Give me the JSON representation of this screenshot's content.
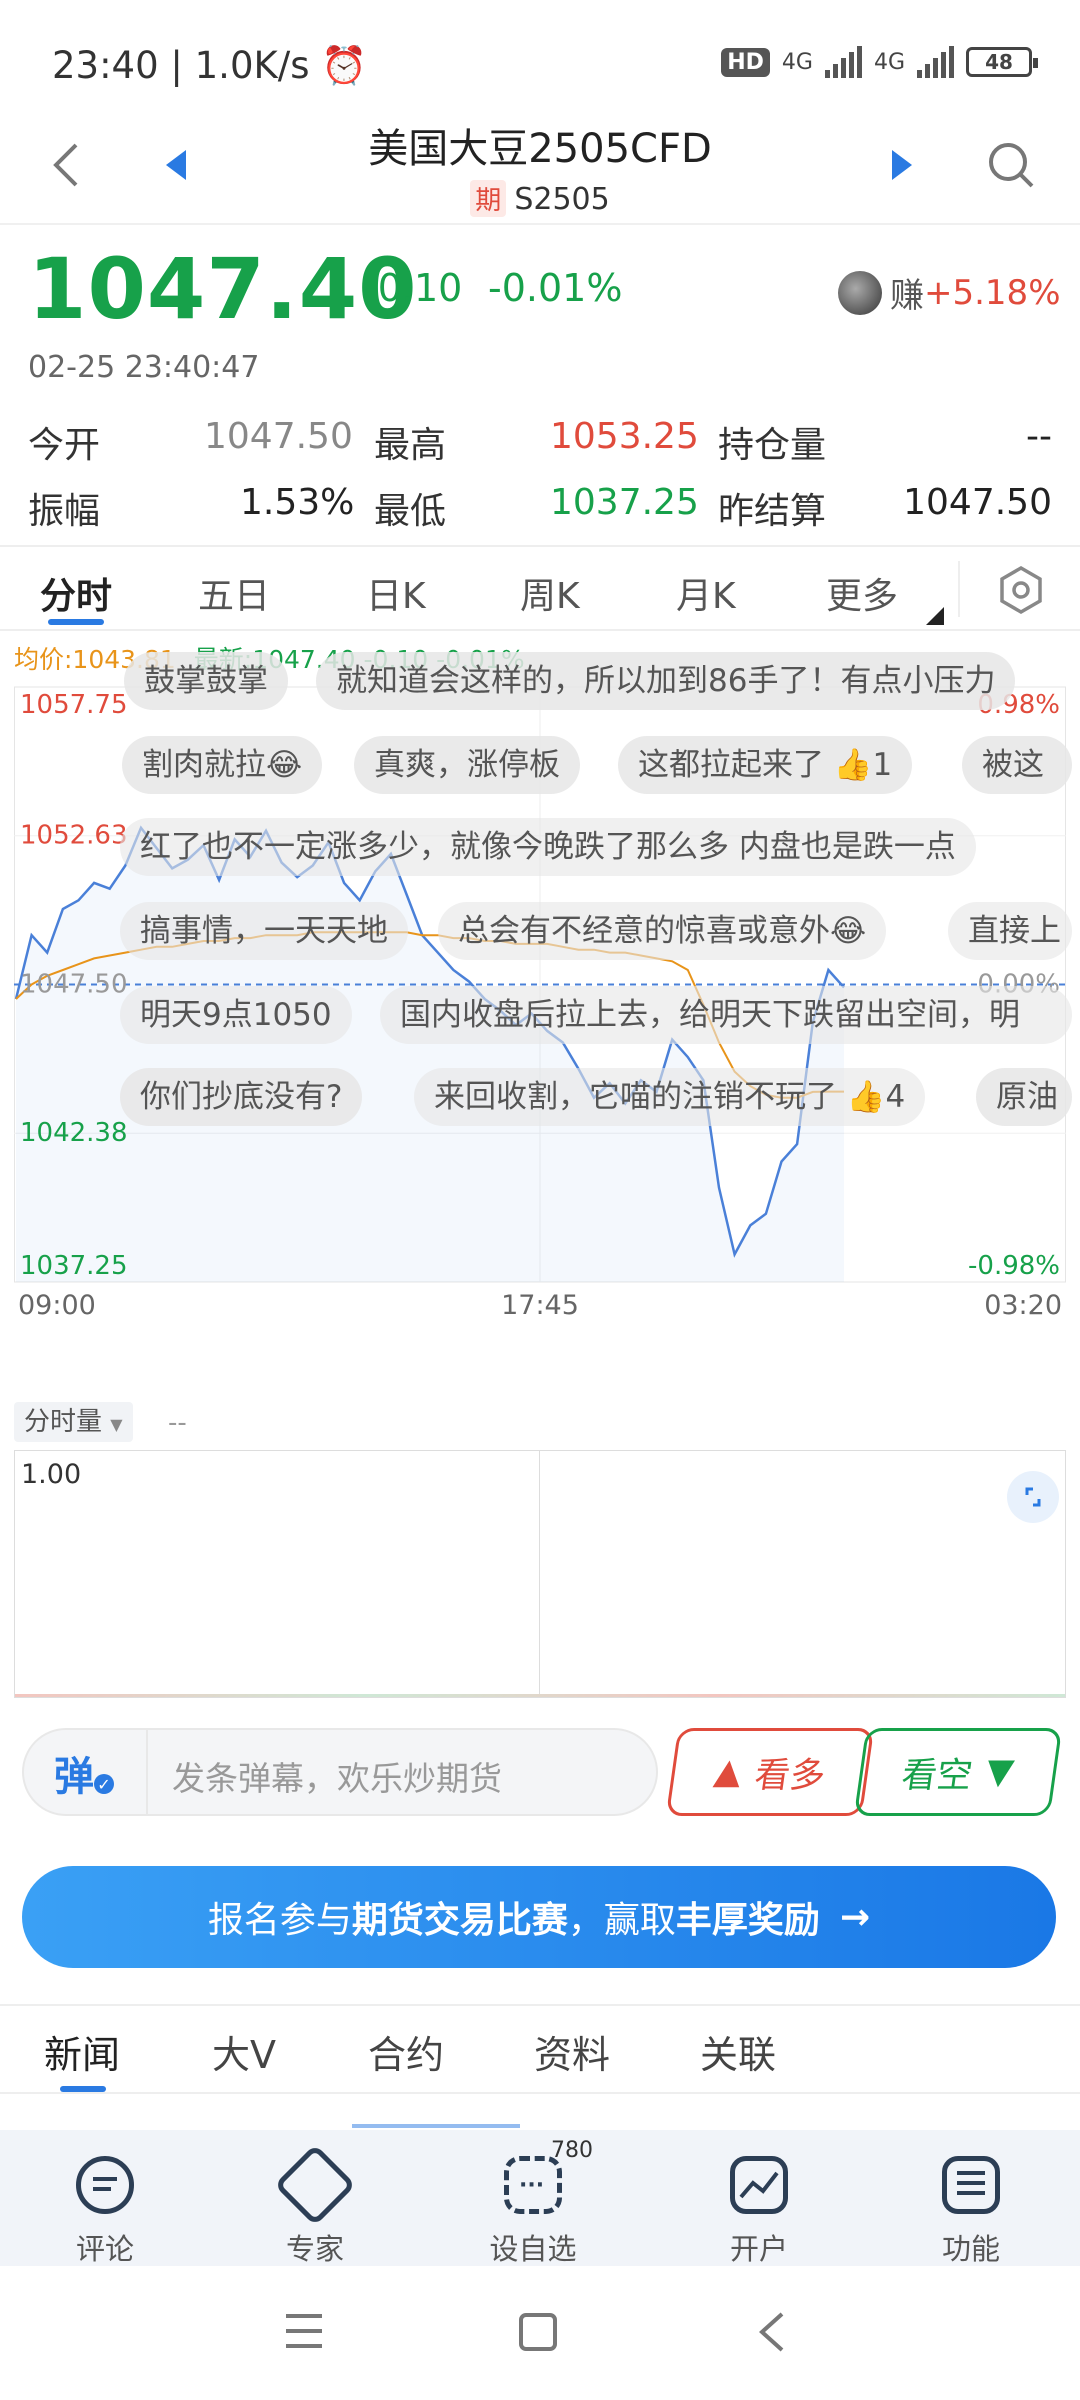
{
  "status_bar": {
    "time": "23:40",
    "speed": "1.0K/s",
    "hd": "HD",
    "net1": "4G",
    "net2": "4G",
    "battery": "48"
  },
  "header": {
    "title": "美国大豆2505CFD",
    "badge": "期",
    "code": "S2505"
  },
  "quote": {
    "price": "1047.40",
    "change": "-0.10",
    "change_pct": "-0.01%",
    "timestamp": "02-25 23:40:47",
    "earn_label": "赚",
    "earn_value": "+5.18%"
  },
  "stats": {
    "open_label": "今开",
    "open": "1047.50",
    "high_label": "最高",
    "high": "1053.25",
    "oi_label": "持仓量",
    "oi": "--",
    "amp_label": "振幅",
    "amp": "1.53%",
    "low_label": "最低",
    "low": "1037.25",
    "settle_label": "昨结算",
    "settle": "1047.50"
  },
  "chart_tabs": [
    "分时",
    "五日",
    "日K",
    "周K",
    "月K",
    "更多"
  ],
  "chart_info": {
    "avg_label": "均价:1043.81",
    "latest_label": "最新:1047.40",
    "latest_chg": "-0.10",
    "latest_pct": "-0.01%"
  },
  "chart_data": {
    "type": "line",
    "y_left_ticks": [
      "1057.75",
      "1052.63",
      "1047.50",
      "1042.38",
      "1037.25"
    ],
    "y_right_ticks": [
      "0.98%",
      "0.00%",
      "-0.98%"
    ],
    "x_ticks": [
      "09:00",
      "17:45",
      "03:20"
    ],
    "ylim": [
      1037.25,
      1057.75
    ],
    "reference": 1047.5,
    "series": [
      {
        "name": "价格",
        "values": [
          1047.0,
          1049.2,
          1048.6,
          1050.1,
          1050.4,
          1051.0,
          1050.8,
          1051.6,
          1052.9,
          1052.2,
          1051.5,
          1051.8,
          1052.3,
          1051.1,
          1052.5,
          1051.9,
          1052.8,
          1051.7,
          1051.2,
          1051.6,
          1052.4,
          1051.0,
          1050.4,
          1051.4,
          1052.0,
          1050.6,
          1049.2,
          1048.6,
          1048.0,
          1047.6,
          1047.0,
          1046.6,
          1046.1,
          1046.5,
          1045.9,
          1045.5,
          1044.6,
          1043.6,
          1044.1,
          1043.4,
          1044.2,
          1043.8,
          1045.6,
          1045.0,
          1044.2,
          1040.5,
          1038.2,
          1039.2,
          1039.6,
          1041.4,
          1042.0,
          1046.2,
          1048.0,
          1047.4
        ]
      },
      {
        "name": "均价",
        "values": [
          1047.0,
          1047.5,
          1047.8,
          1048.0,
          1048.2,
          1048.4,
          1048.5,
          1048.6,
          1048.7,
          1048.8,
          1048.8,
          1048.9,
          1049.0,
          1049.0,
          1049.1,
          1049.1,
          1049.2,
          1049.2,
          1049.2,
          1049.3,
          1049.3,
          1049.3,
          1049.3,
          1049.3,
          1049.3,
          1049.3,
          1049.2,
          1049.2,
          1049.1,
          1049.1,
          1049.0,
          1049.0,
          1048.9,
          1048.9,
          1048.9,
          1048.8,
          1048.7,
          1048.7,
          1048.6,
          1048.6,
          1048.5,
          1048.4,
          1048.3,
          1048.0,
          1046.8,
          1045.5,
          1044.5,
          1044.0,
          1043.7,
          1043.6,
          1043.6,
          1043.8,
          1043.81,
          1043.81
        ]
      }
    ],
    "grid": true
  },
  "danmu": [
    "鼓掌鼓掌",
    "就知道会这样的，所以加到86手了！有点小压力",
    "割肉就拉😂",
    "真爽，涨停板",
    "这都拉起来了",
    "1",
    "被这",
    "红了也不一定涨多少，就像今晚跌了那么多 内盘也是跌一点",
    "搞事情，一天天地",
    "总会有不经意的惊喜或意外😂",
    "直接上",
    "明天9点1050",
    "国内收盘后拉上去，给明天下跌留出空间，明",
    "你们抄底没有?",
    "来回收割，它喵的注销不玩了",
    "4",
    "原油"
  ],
  "volume": {
    "label": "分时量",
    "extra": "--",
    "top_tick": "1.00"
  },
  "input": {
    "danmu_icon": "弹",
    "placeholder": "发条弹幕，欢乐炒期货",
    "bull_label": "看多",
    "bear_label": "看空"
  },
  "banner": {
    "t1": "报名参与",
    "t2": "期货交易比赛",
    "t3": "，赢取",
    "t4": "丰厚奖励"
  },
  "news_tabs": [
    "新闻",
    "大V",
    "合约",
    "资料",
    "关联"
  ],
  "bottom_nav": [
    {
      "label": "评论",
      "icon": "comment-icon"
    },
    {
      "label": "专家",
      "icon": "expert-icon"
    },
    {
      "label": "设自选",
      "icon": "add-favorite-icon",
      "badge": "780"
    },
    {
      "label": "开户",
      "icon": "open-account-icon"
    },
    {
      "label": "功能",
      "icon": "menu-icon"
    }
  ],
  "colors": {
    "up": "#e04b3c",
    "down": "#17a14a",
    "accent": "#2a7ae2",
    "avg": "#e8941a"
  }
}
